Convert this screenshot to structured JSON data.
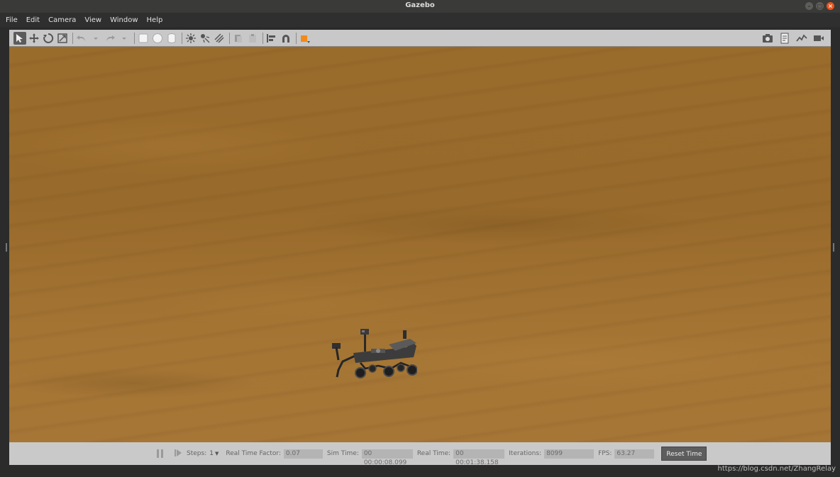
{
  "window": {
    "title": "Gazebo"
  },
  "menu": [
    {
      "label": "File",
      "name": "menu-file"
    },
    {
      "label": "Edit",
      "name": "menu-edit"
    },
    {
      "label": "Camera",
      "name": "menu-camera"
    },
    {
      "label": "View",
      "name": "menu-view"
    },
    {
      "label": "Window",
      "name": "menu-window"
    },
    {
      "label": "Help",
      "name": "menu-help"
    }
  ],
  "toolbar": {
    "left_icons": [
      "select-arrow-icon",
      "translate-icon",
      "rotate-icon",
      "scale-icon",
      "undo-icon",
      "undo-dropdown-icon",
      "redo-icon",
      "redo-dropdown-icon",
      "box-shape-icon",
      "sphere-shape-icon",
      "cylinder-shape-icon",
      "point-light-icon",
      "spot-light-icon",
      "directional-light-icon",
      "copy-icon",
      "paste-icon",
      "align-icon",
      "snap-icon",
      "view-angle-icon"
    ],
    "right_icons": [
      "screenshot-icon",
      "log-icon",
      "plot-icon",
      "record-video-icon"
    ]
  },
  "status": {
    "steps_label": "Steps:",
    "steps_value": "1",
    "rtf_label": "Real Time Factor:",
    "rtf_value": "0.07",
    "sim_time_label": "Sim Time:",
    "sim_time_value": "00 00:00:08.099",
    "real_time_label": "Real Time:",
    "real_time_value": "00 00:01:38.158",
    "iterations_label": "Iterations:",
    "iterations_value": "8099",
    "fps_label": "FPS:",
    "fps_value": "63.27",
    "reset_label": "Reset Time"
  },
  "watermark": "https://blog.csdn.net/ZhangRelay",
  "colors": {
    "terrain": "#9a6c2c",
    "close_button": "#e95420",
    "view_angle_accent": "#f28a1a"
  }
}
